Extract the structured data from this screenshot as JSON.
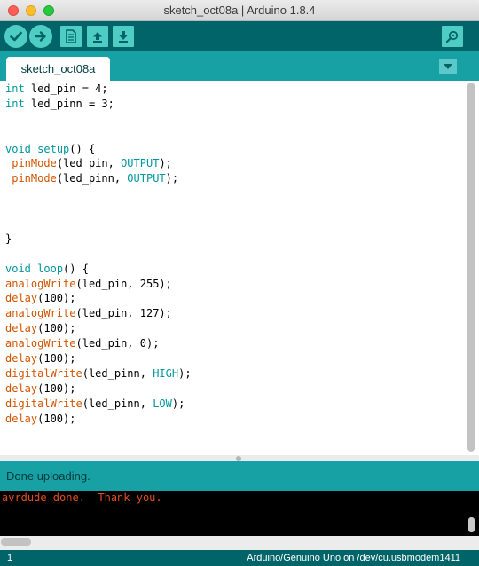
{
  "window": {
    "title": "sketch_oct08a | Arduino 1.8.4"
  },
  "toolbar": {
    "buttons": [
      {
        "name": "verify",
        "icon": "check-icon"
      },
      {
        "name": "upload",
        "icon": "arrow-right-icon"
      },
      {
        "name": "new",
        "icon": "file-icon"
      },
      {
        "name": "open",
        "icon": "arrow-up-icon"
      },
      {
        "name": "save",
        "icon": "arrow-down-icon"
      },
      {
        "name": "serial-monitor",
        "icon": "magnifier-icon"
      }
    ]
  },
  "tabs": [
    {
      "label": "sketch_oct08a"
    }
  ],
  "editor": {
    "lines": [
      "int led_pin = 4;",
      "int led_pinn = 3;",
      "",
      "",
      "void setup() {",
      " pinMode(led_pin, OUTPUT);",
      " pinMode(led_pinn, OUTPUT);",
      "",
      "",
      "",
      "}",
      "",
      "void loop() {",
      "analogWrite(led_pin, 255);",
      "delay(100);",
      "analogWrite(led_pin, 127);",
      "delay(100);",
      "analogWrite(led_pin, 0);",
      "delay(100);",
      "digitalWrite(led_pinn, HIGH);",
      "delay(100);",
      "digitalWrite(led_pinn, LOW);",
      "delay(100);"
    ]
  },
  "status": {
    "message": "Done uploading."
  },
  "console": {
    "output": "avrdude done.  Thank you."
  },
  "footer": {
    "line_number": "1",
    "board": "Arduino/Genuino Uno on /dev/cu.usbmodem1411"
  },
  "colors": {
    "toolbar": "#006468",
    "accent": "#17a1a5",
    "button": "#4fccc3",
    "keyword": "#00979c",
    "function": "#d35400",
    "console_text": "#e34c22"
  }
}
